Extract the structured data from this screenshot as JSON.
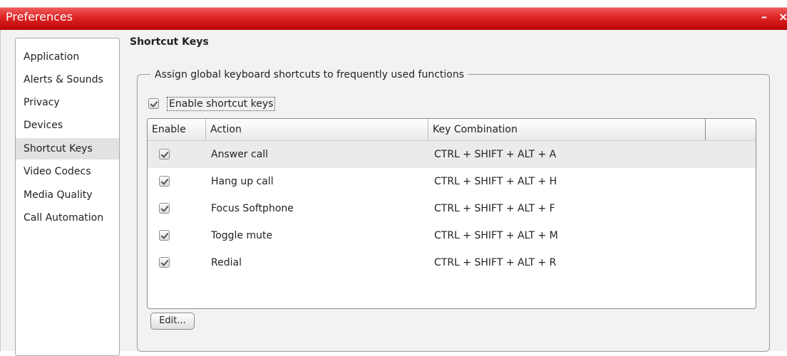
{
  "window": {
    "title": "Preferences",
    "minimize_label": "–",
    "close_label": "×"
  },
  "sidebar": {
    "items": [
      {
        "label": "Application"
      },
      {
        "label": "Alerts & Sounds"
      },
      {
        "label": "Privacy"
      },
      {
        "label": "Devices"
      },
      {
        "label": "Shortcut Keys",
        "selected": true
      },
      {
        "label": "Video Codecs"
      },
      {
        "label": "Media Quality"
      },
      {
        "label": "Call Automation"
      }
    ]
  },
  "main": {
    "section_title": "Shortcut Keys",
    "group_title": "Assign global keyboard shortcuts to frequently used functions",
    "enable_checkbox": {
      "label": "Enable shortcut keys",
      "checked": true
    },
    "table": {
      "columns": [
        "Enable",
        "Action",
        "Key Combination"
      ],
      "rows": [
        {
          "enabled": true,
          "action": "Answer call",
          "keys": "CTRL + SHIFT + ALT + A"
        },
        {
          "enabled": true,
          "action": "Hang up call",
          "keys": "CTRL + SHIFT + ALT + H"
        },
        {
          "enabled": true,
          "action": "Focus Softphone",
          "keys": "CTRL + SHIFT + ALT + F"
        },
        {
          "enabled": true,
          "action": "Toggle mute",
          "keys": "CTRL + SHIFT + ALT + M"
        },
        {
          "enabled": true,
          "action": "Redial",
          "keys": "CTRL + SHIFT + ALT + R"
        }
      ]
    },
    "edit_button": "Edit..."
  },
  "colors": {
    "titlebar": "#d01414",
    "panel_bg": "#f2f2f2",
    "selected_item_bg": "#e2e2e2"
  }
}
